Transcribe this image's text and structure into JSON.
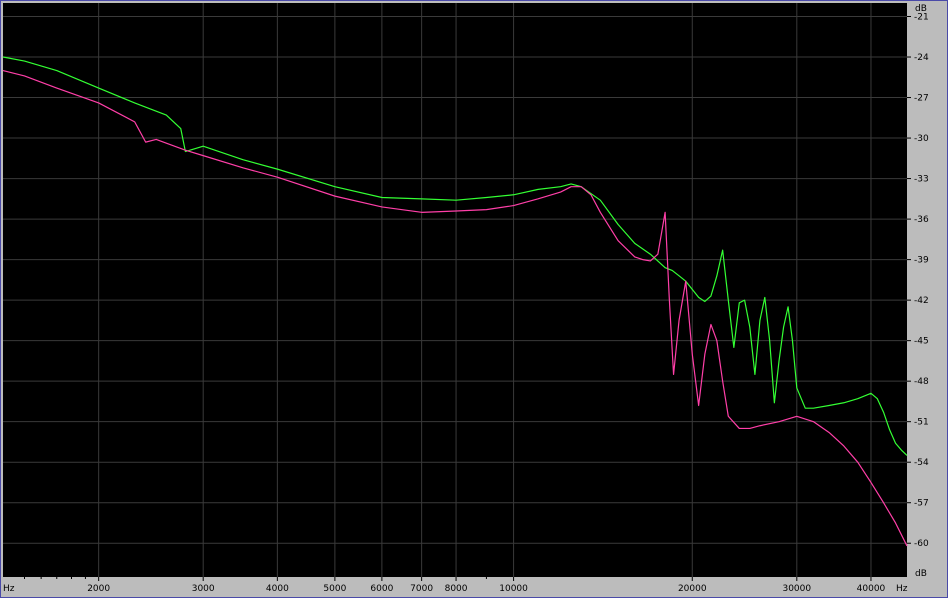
{
  "colors": {
    "plot_bg": "#000000",
    "grid": "#3a3a3a",
    "border": "#4a4aa8",
    "panel": "#bcbcbc",
    "green": "#33ff33",
    "magenta": "#ff3fa8"
  },
  "chart_data": {
    "type": "line",
    "x_scale": "log",
    "x_unit_label": "Hz",
    "y_unit_label": "dB",
    "xlim": [
      1380,
      46000
    ],
    "ylim": [
      -62.5,
      -20
    ],
    "grid": true,
    "x_ticks": [
      {
        "v": 2000,
        "label": "2000"
      },
      {
        "v": 3000,
        "label": "3000"
      },
      {
        "v": 4000,
        "label": "4000"
      },
      {
        "v": 5000,
        "label": "5000"
      },
      {
        "v": 6000,
        "label": "6000"
      },
      {
        "v": 7000,
        "label": "7000"
      },
      {
        "v": 8000,
        "label": "8000"
      },
      {
        "v": 10000,
        "label": "10000"
      },
      {
        "v": 20000,
        "label": "20000"
      },
      {
        "v": 30000,
        "label": "30000"
      },
      {
        "v": 40000,
        "label": "40000"
      }
    ],
    "y_ticks": [
      -21,
      -24,
      -27,
      -30,
      -33,
      -36,
      -39,
      -42,
      -45,
      -48,
      -51,
      -54,
      -57,
      -60
    ],
    "series": [
      {
        "color": "#33ff33",
        "x": [
          1380,
          1500,
          1700,
          2000,
          2300,
          2600,
          2750,
          2800,
          3000,
          3500,
          4000,
          5000,
          6000,
          7000,
          8000,
          9000,
          10000,
          11000,
          12000,
          12500,
          13000,
          14000,
          15000,
          16000,
          17000,
          18000,
          18500,
          19000,
          19500,
          20000,
          20500,
          21000,
          21500,
          22000,
          22500,
          23000,
          23500,
          24000,
          24500,
          25000,
          25500,
          26000,
          26500,
          27000,
          27500,
          28000,
          28500,
          29000,
          29500,
          30000,
          31000,
          32000,
          34000,
          36000,
          38000,
          40000,
          41000,
          42000,
          43000,
          44000,
          45000,
          46000
        ],
        "y": [
          -24.0,
          -24.3,
          -25.0,
          -26.3,
          -27.4,
          -28.3,
          -29.3,
          -31.0,
          -30.6,
          -31.6,
          -32.3,
          -33.6,
          -34.4,
          -34.5,
          -34.6,
          -34.4,
          -34.2,
          -33.8,
          -33.6,
          -33.4,
          -33.6,
          -34.6,
          -36.4,
          -37.8,
          -38.6,
          -39.6,
          -39.8,
          -40.2,
          -40.6,
          -41.2,
          -41.8,
          -42.1,
          -41.7,
          -40.2,
          -38.3,
          -42.0,
          -45.5,
          -42.2,
          -42.0,
          -44.0,
          -47.5,
          -43.5,
          -41.8,
          -45.0,
          -49.6,
          -46.5,
          -44.0,
          -42.5,
          -45.0,
          -48.5,
          -50.0,
          -50.0,
          -49.8,
          -49.6,
          -49.3,
          -48.9,
          -49.3,
          -50.3,
          -51.6,
          -52.6,
          -53.1,
          -53.5
        ]
      },
      {
        "color": "#ff3fa8",
        "x": [
          1380,
          1500,
          1700,
          2000,
          2300,
          2400,
          2500,
          2800,
          3000,
          3500,
          4000,
          5000,
          6000,
          7000,
          8000,
          9000,
          10000,
          11000,
          12000,
          12500,
          13000,
          13500,
          14000,
          15000,
          16000,
          16500,
          17000,
          17500,
          18000,
          18300,
          18600,
          19000,
          19500,
          20000,
          20500,
          21000,
          21500,
          22000,
          22500,
          23000,
          24000,
          25000,
          26000,
          28000,
          30000,
          32000,
          34000,
          36000,
          38000,
          40000,
          42000,
          44000,
          46000
        ],
        "y": [
          -25.0,
          -25.4,
          -26.3,
          -27.4,
          -28.8,
          -30.3,
          -30.1,
          -30.9,
          -31.3,
          -32.2,
          -32.9,
          -34.3,
          -35.1,
          -35.5,
          -35.4,
          -35.3,
          -35.0,
          -34.5,
          -34.0,
          -33.6,
          -33.6,
          -34.2,
          -35.5,
          -37.6,
          -38.8,
          -39.0,
          -39.1,
          -38.6,
          -35.5,
          -42.0,
          -47.5,
          -43.5,
          -40.6,
          -46.0,
          -49.8,
          -46.0,
          -43.8,
          -45.0,
          -48.0,
          -50.6,
          -51.5,
          -51.5,
          -51.3,
          -51.0,
          -50.6,
          -51.0,
          -51.8,
          -52.8,
          -54.0,
          -55.5,
          -57.0,
          -58.5,
          -60.2
        ]
      }
    ]
  }
}
